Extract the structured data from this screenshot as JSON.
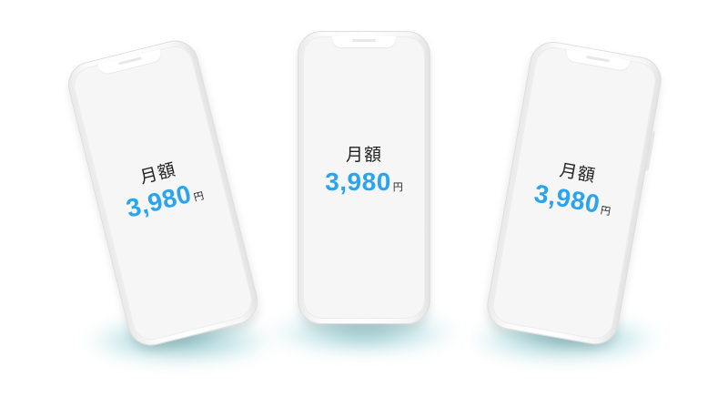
{
  "phones": [
    {
      "label": "月額",
      "amount": "3,980",
      "unit": "円"
    },
    {
      "label": "月額",
      "amount": "3,980",
      "unit": "円"
    },
    {
      "label": "月額",
      "amount": "3,980",
      "unit": "円"
    }
  ],
  "colors": {
    "price": "#2aa4ee",
    "text": "#222222",
    "shadow": "#1f8f99",
    "phone_body": "#f8f8f8"
  }
}
